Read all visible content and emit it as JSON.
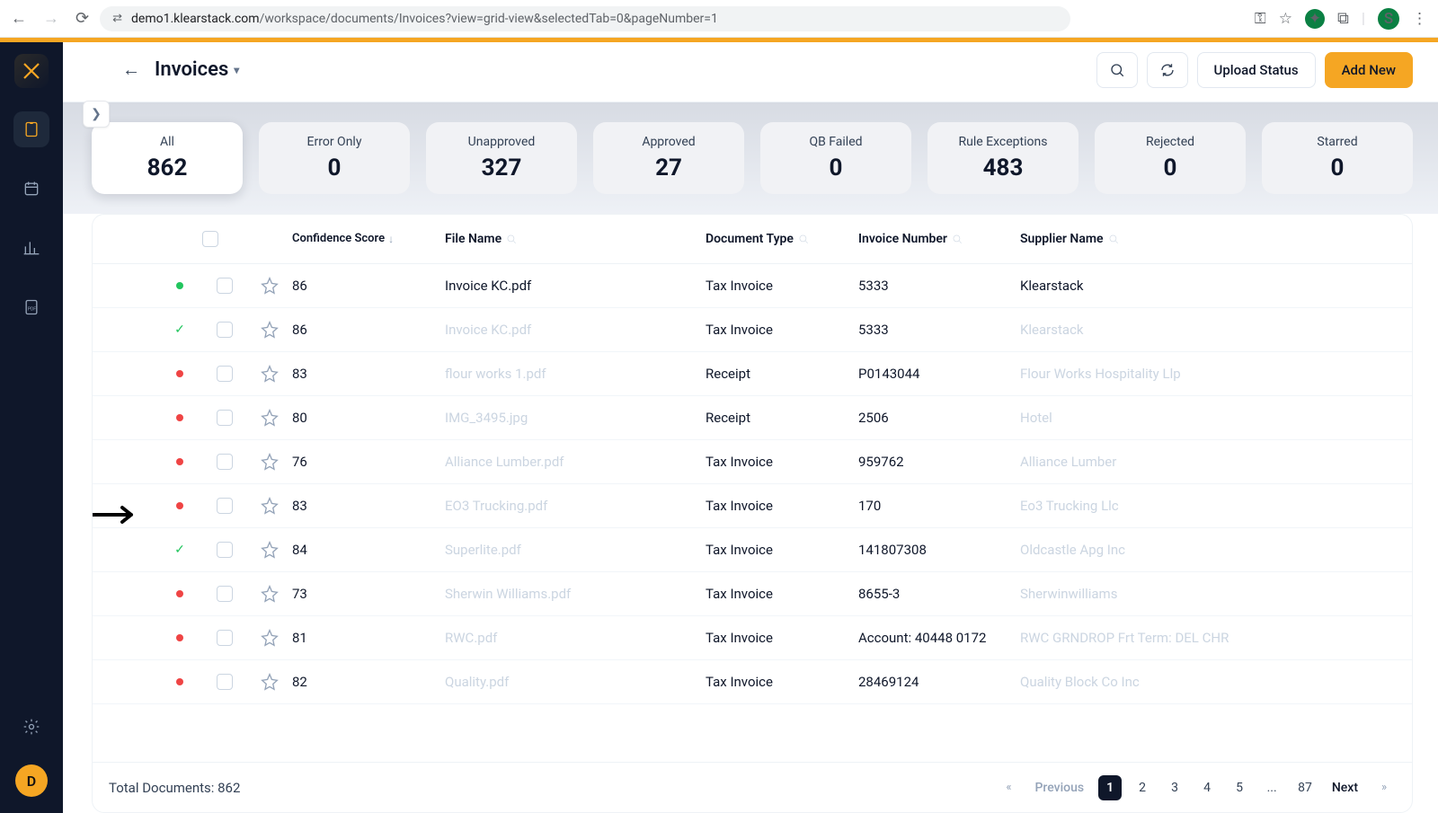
{
  "browser": {
    "url_domain": "demo1.klearstack.com",
    "url_path": "/workspace/documents/Invoices?view=grid-view&selectedTab=0&pageNumber=1",
    "profile_initial": "S"
  },
  "header": {
    "title": "Invoices",
    "upload_status": "Upload Status",
    "add_new": "Add New"
  },
  "filters": [
    {
      "label": "All",
      "count": "862"
    },
    {
      "label": "Error Only",
      "count": "0"
    },
    {
      "label": "Unapproved",
      "count": "327"
    },
    {
      "label": "Approved",
      "count": "27"
    },
    {
      "label": "QB Failed",
      "count": "0"
    },
    {
      "label": "Rule Exceptions",
      "count": "483"
    },
    {
      "label": "Rejected",
      "count": "0"
    },
    {
      "label": "Starred",
      "count": "0"
    }
  ],
  "columns": {
    "confidence": "Confidence Score",
    "file": "File Name",
    "doctype": "Document Type",
    "invoicenum": "Invoice Number",
    "supplier": "Supplier Name"
  },
  "rows": [
    {
      "status": "green",
      "score": "86",
      "file": "Invoice KC.pdf",
      "file_faded": false,
      "doctype": "Tax Invoice",
      "invnum": "5333",
      "supplier": "Klearstack",
      "supplier_faded": false
    },
    {
      "status": "check",
      "score": "86",
      "file": "Invoice KC.pdf",
      "file_faded": true,
      "doctype": "Tax Invoice",
      "invnum": "5333",
      "supplier": "Klearstack",
      "supplier_faded": true
    },
    {
      "status": "red",
      "score": "83",
      "file": "flour works 1.pdf",
      "file_faded": true,
      "doctype": "Receipt",
      "invnum": "P0143044",
      "supplier": "Flour Works Hospitality Llp",
      "supplier_faded": true
    },
    {
      "status": "red",
      "score": "80",
      "file": "IMG_3495.jpg",
      "file_faded": true,
      "doctype": "Receipt",
      "invnum": "2506",
      "supplier": "Hotel",
      "supplier_faded": true
    },
    {
      "status": "red",
      "score": "76",
      "file": "Alliance Lumber.pdf",
      "file_faded": true,
      "doctype": "Tax Invoice",
      "invnum": "959762",
      "supplier": "Alliance Lumber",
      "supplier_faded": true
    },
    {
      "status": "red",
      "score": "83",
      "file": "EO3 Trucking.pdf",
      "file_faded": true,
      "doctype": "Tax Invoice",
      "invnum": "170",
      "supplier": "Eo3 Trucking Llc",
      "supplier_faded": true
    },
    {
      "status": "check",
      "score": "84",
      "file": "Superlite.pdf",
      "file_faded": true,
      "doctype": "Tax Invoice",
      "invnum": "141807308",
      "supplier": "Oldcastle Apg Inc",
      "supplier_faded": true
    },
    {
      "status": "red",
      "score": "73",
      "file": "Sherwin Williams.pdf",
      "file_faded": true,
      "doctype": "Tax Invoice",
      "invnum": "8655-3",
      "supplier": "Sherwinwilliams",
      "supplier_faded": true
    },
    {
      "status": "red",
      "score": "81",
      "file": "RWC.pdf",
      "file_faded": true,
      "doctype": "Tax Invoice",
      "invnum": "Account: 40448 0172",
      "supplier": "RWC GRNDROP Frt Term: DEL CHR",
      "supplier_faded": true
    },
    {
      "status": "red",
      "score": "82",
      "file": "Quality.pdf",
      "file_faded": true,
      "doctype": "Tax Invoice",
      "invnum": "28469124",
      "supplier": "Quality Block Co Inc",
      "supplier_faded": true
    }
  ],
  "footer": {
    "total_label": "Total Documents: 862",
    "pages": [
      "1",
      "2",
      "3",
      "4",
      "5",
      "...",
      "87"
    ],
    "previous": "Previous",
    "next": "Next"
  },
  "sidebar": {
    "avatar": "D"
  }
}
